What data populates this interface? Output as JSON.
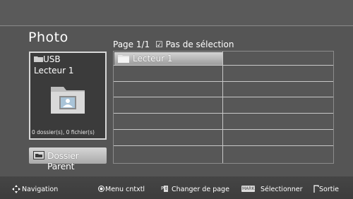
{
  "header": {
    "title": "Photo",
    "page_info": "Page 1/1",
    "selection_status": "Pas de sélection"
  },
  "source_panel": {
    "device_label": "USB",
    "drive_label": "Lecteur 1",
    "item_count": "0 dossier(s), 0 fichier(s)",
    "icon": "folder-picture-icon"
  },
  "parent_button": {
    "label": "Dossier Parent",
    "icon": "parent-folder-icon"
  },
  "file_grid": {
    "items": [
      {
        "label": "Lecteur 1",
        "icon": "folder-icon",
        "selected": true
      }
    ]
  },
  "footer": {
    "navigation": "Navigation",
    "context_menu": "Menu cntxtl",
    "page_key": "P",
    "change_page": "Changer de page",
    "mark_key": "MARK",
    "select": "Sélectionner",
    "exit": "Sortie"
  },
  "colors": {
    "background": "#555555",
    "panel": "#3b3b3b",
    "highlight": "#c0c0c0",
    "text": "#ffffff"
  }
}
